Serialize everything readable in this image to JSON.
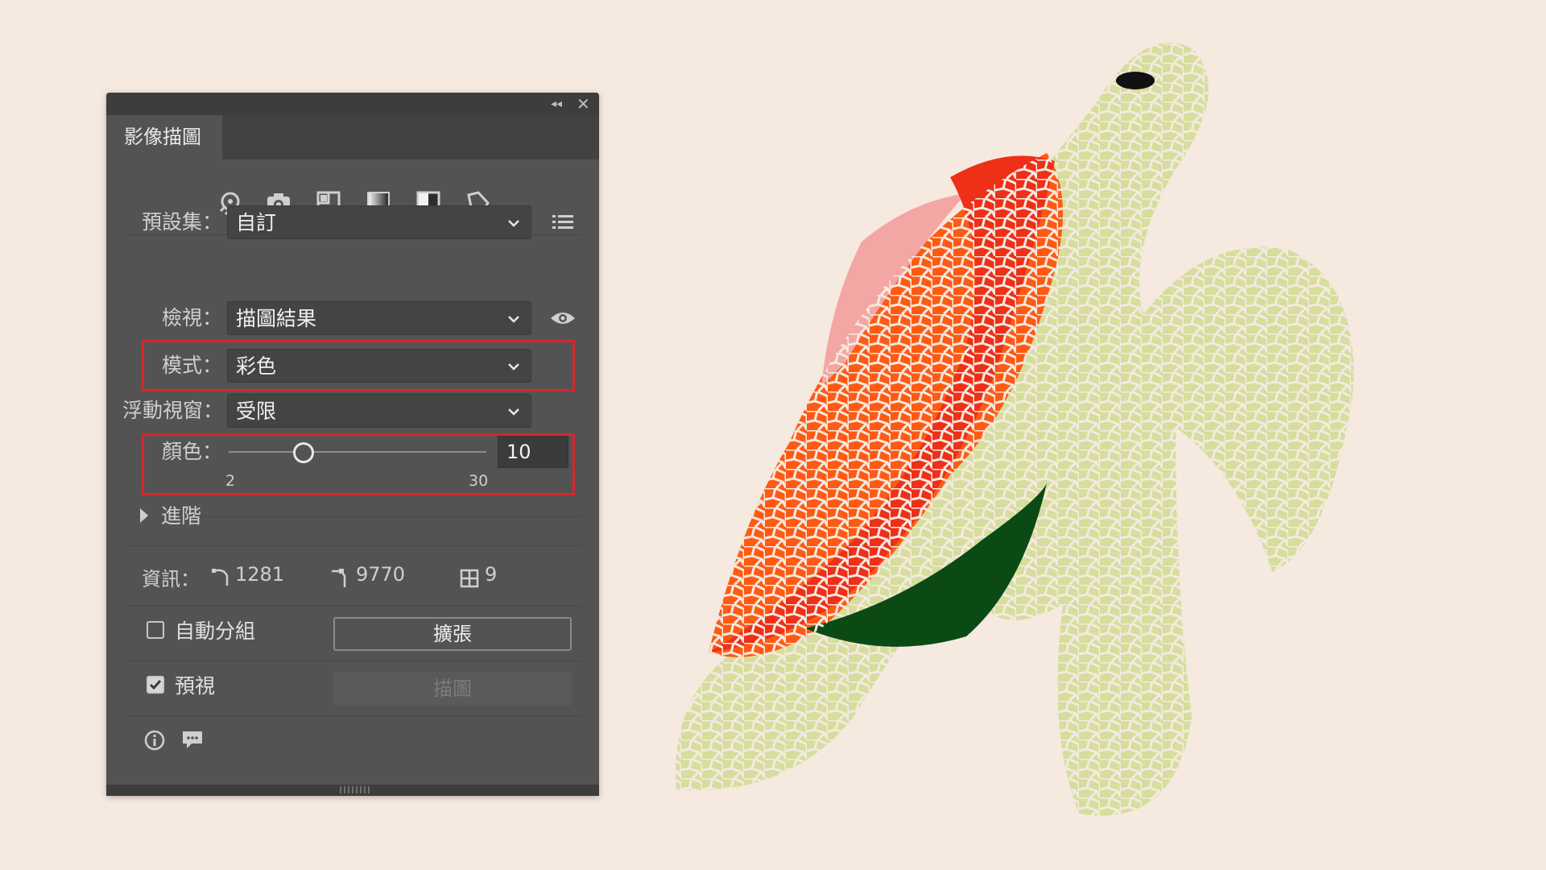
{
  "panel": {
    "title": "影像描圖",
    "titlebar_icons": [
      "collapse-icon",
      "close-icon"
    ],
    "toolbar_icons": [
      "auto-color-icon",
      "high-color-camera-icon",
      "low-color-icon",
      "grayscale-icon",
      "black-white-icon",
      "outline-icon"
    ]
  },
  "form": {
    "preset_label": "預設集：",
    "preset_value": "自訂",
    "view_label": "檢視：",
    "view_value": "描圖結果",
    "mode_label": "模式：",
    "mode_value": "彩色",
    "palette_label": "浮動視窗：",
    "palette_value": "受限",
    "colors_label": "顏色：",
    "colors_value": "10",
    "colors_min": "2",
    "colors_max": "30",
    "colors_level": 0.29
  },
  "advanced": {
    "label": "進階"
  },
  "info": {
    "label": "資訊：",
    "paths": "1281",
    "anchors": "9770",
    "colors": "9"
  },
  "options": {
    "auto_group_label": "自動分組",
    "auto_group_checked": false,
    "expand_label": "擴張",
    "preview_label": "預視",
    "preview_checked": true,
    "trace_label": "描圖"
  },
  "colors": {
    "panel_bg": "#535353",
    "highlight_box": "#d9252b",
    "canvas_bg": "#f5e9e0",
    "turtle_body": "#d5de9c",
    "shell_orange": "#ff5a14",
    "shell_red": "#ee3018",
    "shell_pink": "#f3a6a3",
    "belly_green": "#0b4a14"
  }
}
